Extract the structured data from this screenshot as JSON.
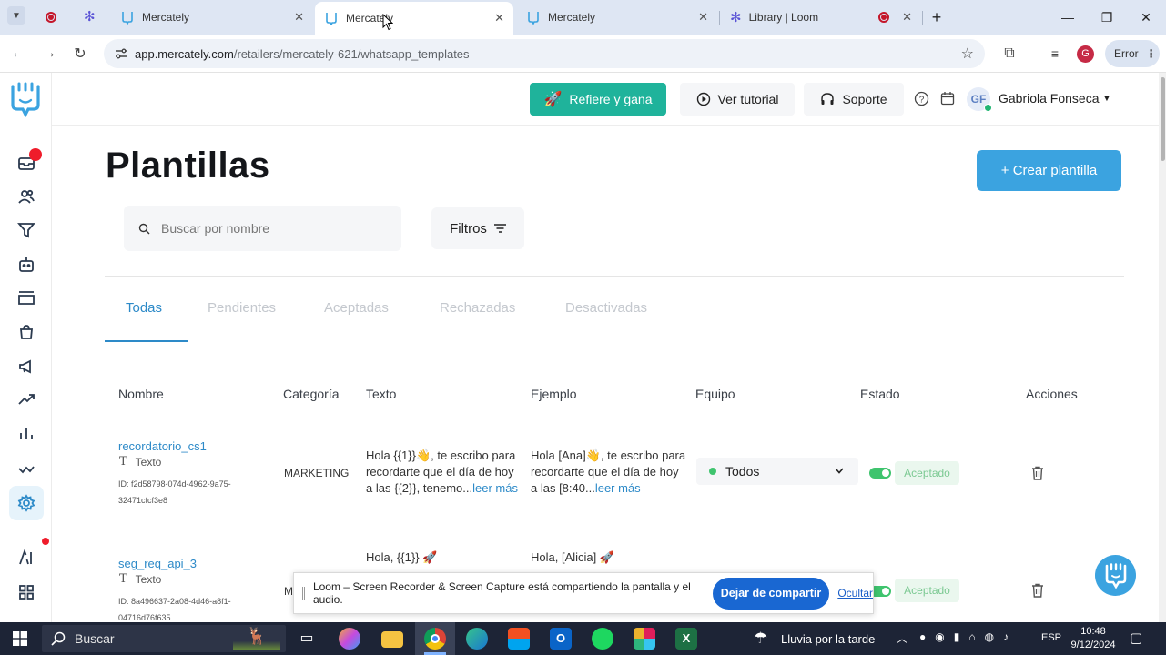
{
  "browser": {
    "tabs": [
      {
        "title": "Mercately"
      },
      {
        "title": "Mercately"
      },
      {
        "title": "Mercately"
      },
      {
        "title": "Library | Loom"
      }
    ],
    "url_host": "app.mercately.com",
    "url_path": "/retailers/mercately-621/whatsapp_templates",
    "profile_initial": "G",
    "error_label": "Error"
  },
  "topbar": {
    "refiere": "Refiere y gana",
    "tutorial": "Ver tutorial",
    "soporte": "Soporte",
    "user_initials": "GF",
    "user_name": "Gabriola Fonseca"
  },
  "page": {
    "title": "Plantillas",
    "create_button": "+ Crear plantilla",
    "search_placeholder": "Buscar por nombre",
    "filters_button": "Filtros"
  },
  "status_tabs": [
    "Todas",
    "Pendientes",
    "Aceptadas",
    "Rechazadas",
    "Desactivadas"
  ],
  "table": {
    "headers": [
      "Nombre",
      "Categoría",
      "Texto",
      "Ejemplo",
      "Equipo",
      "Estado",
      "Acciones"
    ],
    "rows": [
      {
        "name": "recordatorio_cs1",
        "type": "Texto",
        "id_line1": "ID: f2d58798-074d-4962-9a75-",
        "id_line2": "32471cfcf3e8",
        "category": "MARKETING",
        "text_l1": "Hola {{1}}👋, te escribo para",
        "text_l2": "recordarte que el día de hoy",
        "text_l3": "a las {{2}}, tenemo...",
        "example_l1": "Hola [Ana]👋, te escribo para",
        "example_l2": "recordarte que el día de hoy",
        "example_l3": "a las [8:40...",
        "more": "leer más",
        "team": "Todos",
        "status": "Aceptado"
      },
      {
        "name": "seg_req_api_3",
        "type": "Texto",
        "id_line1": "ID: 8a496637-2a08-4d46-a8f1-",
        "id_line2": "04716d76f635",
        "category": "M",
        "text_l1": "Hola, {{1}} 🚀",
        "example_l1": "Hola, [Alicia] 🚀",
        "status": "Aceptado"
      }
    ]
  },
  "loom": {
    "message": "Loom – Screen Recorder & Screen Capture está compartiendo la pantalla y el audio.",
    "stop": "Dejar de compartir",
    "hide": "Ocultar"
  },
  "taskbar": {
    "search": "Buscar",
    "weather": "Lluvia por la tarde",
    "lang": "ESP",
    "time": "10:48",
    "date": "9/12/2024"
  }
}
